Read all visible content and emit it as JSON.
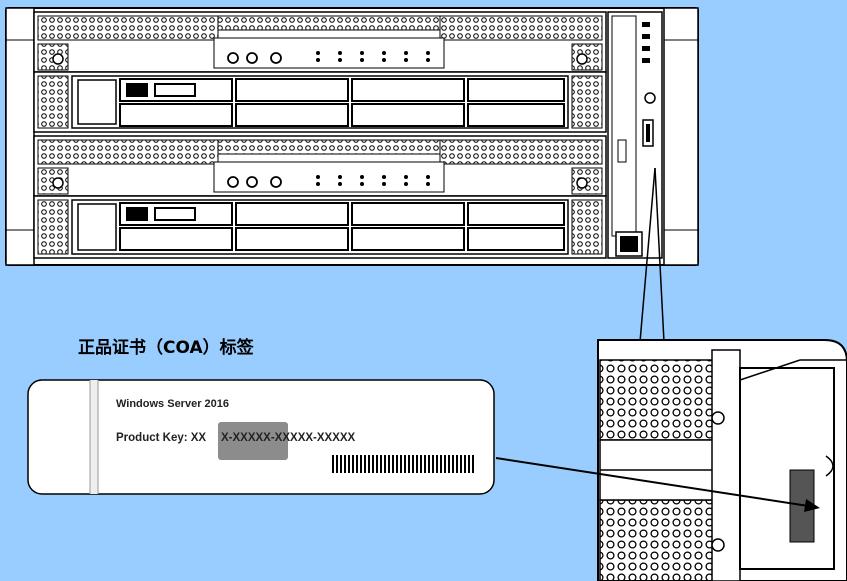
{
  "caption": "正品证书（COA）标签",
  "coa_label": {
    "os_name": "Windows Server 2016",
    "product_key_prefix": "Product Key: XX",
    "product_key_suffix": "X-XXXXX-XXXXX-XXXXX",
    "redaction_color": "#8c8c8c"
  },
  "colors": {
    "background": "#99ccff",
    "chassis": "#ffffff",
    "outline": "#000000",
    "label_fill": "#ffffff"
  },
  "icons": [
    "power-icon",
    "usb-icon",
    "led-indicator-icon"
  ]
}
